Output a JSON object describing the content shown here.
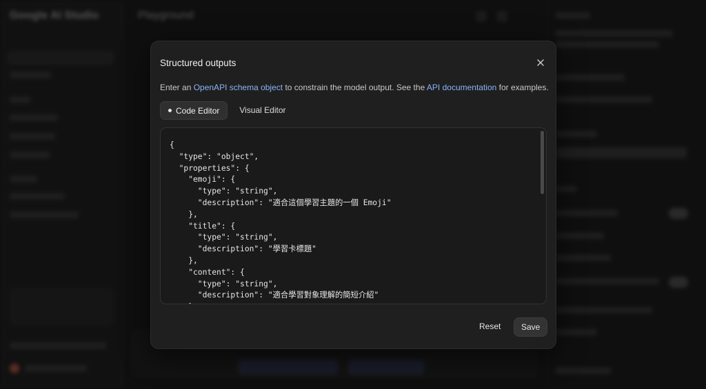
{
  "modal": {
    "title": "Structured outputs",
    "description": {
      "prefix": "Enter an ",
      "link1": "OpenAPI schema object",
      "middle": " to constrain the model output. See the ",
      "link2": "API documentation",
      "suffix": " for examples."
    },
    "tabs": [
      {
        "label": "Code Editor",
        "active": true
      },
      {
        "label": "Visual Editor",
        "active": false
      }
    ],
    "code": "{\n  \"type\": \"object\",\n  \"properties\": {\n    \"emoji\": {\n      \"type\": \"string\",\n      \"description\": \"適合這個學習主題的一個 Emoji\"\n    },\n    \"title\": {\n      \"type\": \"string\",\n      \"description\": \"學習卡標題\"\n    },\n    \"content\": {\n      \"type\": \"string\",\n      \"description\": \"適合學習對象理解的簡短介紹\"\n    },",
    "buttons": {
      "reset": "Reset",
      "save": "Save"
    }
  },
  "background": {
    "brand": "Google AI Studio",
    "page_title": "Playground"
  },
  "colors": {
    "link": "#8ab4f8",
    "modal_bg": "#1f1f1f",
    "editor_bg": "#1a1a1a"
  }
}
